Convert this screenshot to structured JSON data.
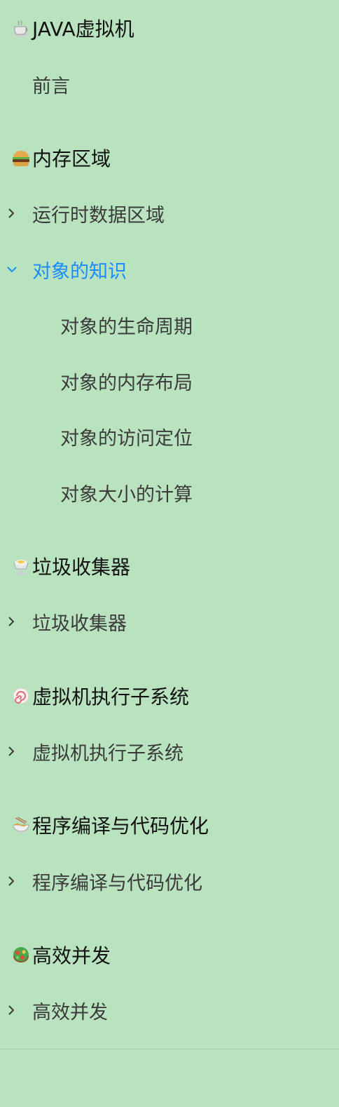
{
  "sections": [
    {
      "icon": "coffee-icon",
      "title": "JAVA虚拟机",
      "items": [
        {
          "label": "前言"
        }
      ]
    },
    {
      "icon": "burger-icon",
      "title": "内存区域",
      "items": [
        {
          "label": "运行时数据区域"
        },
        {
          "label": "对象的知识",
          "expanded": true,
          "children": [
            {
              "label": "对象的生命周期"
            },
            {
              "label": "对象的内存布局"
            },
            {
              "label": "对象的访问定位"
            },
            {
              "label": "对象大小的计算"
            }
          ]
        }
      ]
    },
    {
      "icon": "ice-dessert-icon",
      "title": "垃圾收集器",
      "items": [
        {
          "label": "垃圾收集器"
        }
      ]
    },
    {
      "icon": "fish-cake-icon",
      "title": "虚拟机执行子系统",
      "items": [
        {
          "label": "虚拟机执行子系统"
        }
      ]
    },
    {
      "icon": "noodle-bowl-icon",
      "title": "程序编译与代码优化",
      "items": [
        {
          "label": "程序编译与代码优化"
        }
      ]
    },
    {
      "icon": "salad-icon",
      "title": "高效并发",
      "items": [
        {
          "label": "高效并发"
        }
      ]
    }
  ],
  "colors": {
    "background": "#b9e3bf",
    "active": "#1a8cff",
    "text": "#3b3b3b",
    "heading": "#111111"
  }
}
